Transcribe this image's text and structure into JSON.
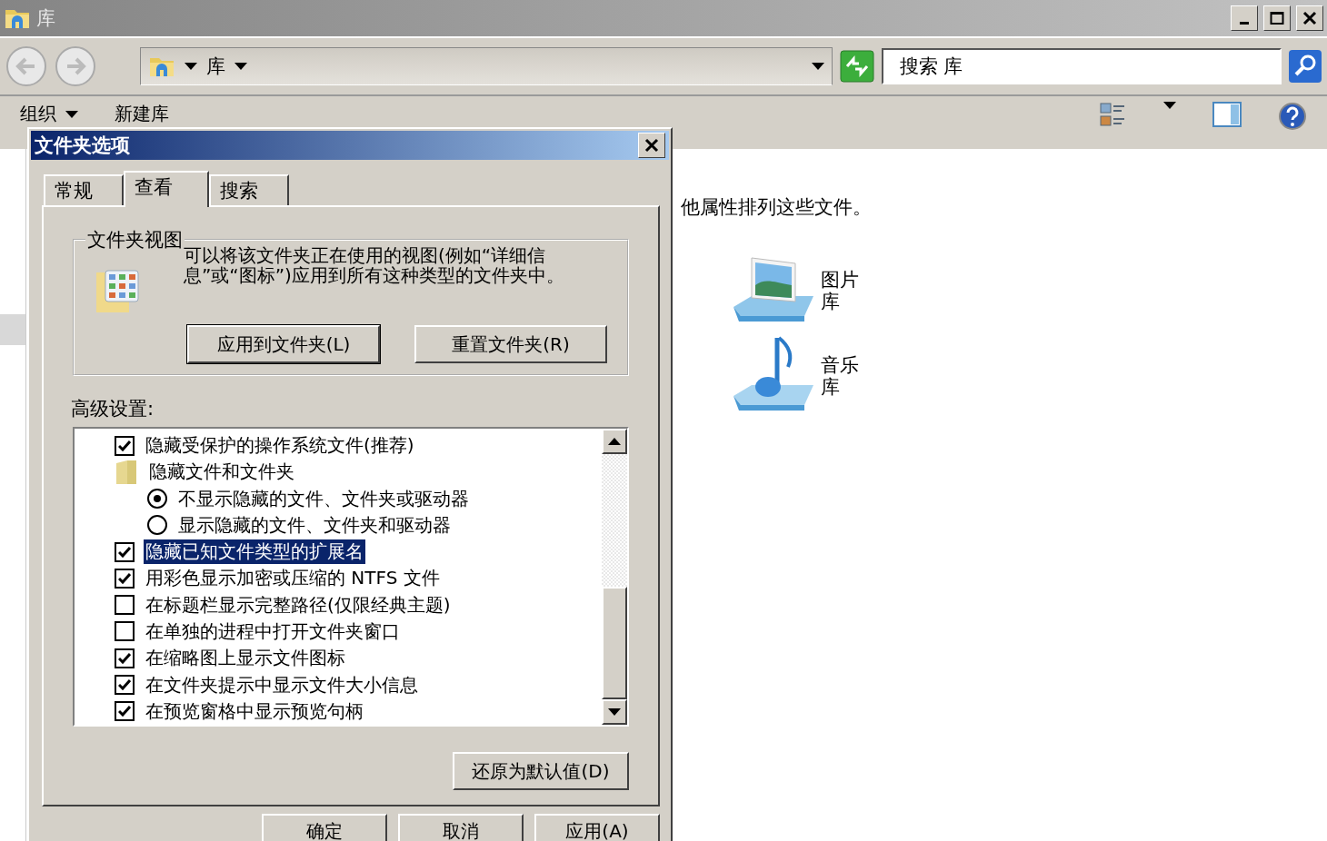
{
  "window": {
    "title": "库"
  },
  "address_bar": {
    "path": "库"
  },
  "search": {
    "placeholder": "搜索 库"
  },
  "toolbar": {
    "items": [
      "组织",
      "新建库"
    ]
  },
  "content": {
    "description": "他属性排列这些文件。",
    "libraries": [
      {
        "name": "图片库",
        "kind": "pictures"
      },
      {
        "name": "音乐库",
        "kind": "music"
      }
    ]
  },
  "dialog": {
    "title": "文件夹选项",
    "tabs": [
      {
        "label": "常规",
        "selected": false
      },
      {
        "label": "查看",
        "selected": true
      },
      {
        "label": "搜索",
        "selected": false
      }
    ],
    "folder_views": {
      "legend": "文件夹视图",
      "description": "可以将该文件夹正在使用的视图(例如“详细信息”或“图标”)应用到所有这种类型的文件夹中。",
      "buttons": [
        "应用到文件夹(L)",
        "重置文件夹(R)"
      ]
    },
    "advanced": {
      "label": "高级设置:",
      "items": [
        {
          "kind": "checkbox",
          "label": "隐藏受保护的操作系统文件(推荐)",
          "checked": true,
          "selected": false
        },
        {
          "kind": "folder",
          "label": "隐藏文件和文件夹",
          "selected": false
        },
        {
          "kind": "radio",
          "label": "不显示隐藏的文件、文件夹或驱动器",
          "checked": true,
          "selected": false
        },
        {
          "kind": "radio",
          "label": "显示隐藏的文件、文件夹和驱动器",
          "checked": false,
          "selected": false
        },
        {
          "kind": "checkbox",
          "label": "隐藏已知文件类型的扩展名",
          "checked": true,
          "selected": true
        },
        {
          "kind": "checkbox",
          "label": "用彩色显示加密或压缩的 NTFS 文件",
          "checked": true,
          "selected": false
        },
        {
          "kind": "checkbox",
          "label": "在标题栏显示完整路径(仅限经典主题)",
          "checked": false,
          "selected": false
        },
        {
          "kind": "checkbox",
          "label": "在单独的进程中打开文件夹窗口",
          "checked": false,
          "selected": false
        },
        {
          "kind": "checkbox",
          "label": "在缩略图上显示文件图标",
          "checked": true,
          "selected": false
        },
        {
          "kind": "checkbox",
          "label": "在文件夹提示中显示文件大小信息",
          "checked": true,
          "selected": false
        },
        {
          "kind": "checkbox",
          "label": "在预览窗格中显示预览句柄",
          "checked": true,
          "selected": false
        }
      ]
    },
    "restore_button": "还原为默认值(D)",
    "buttons": [
      "确定",
      "取消",
      "应用(A)"
    ]
  }
}
